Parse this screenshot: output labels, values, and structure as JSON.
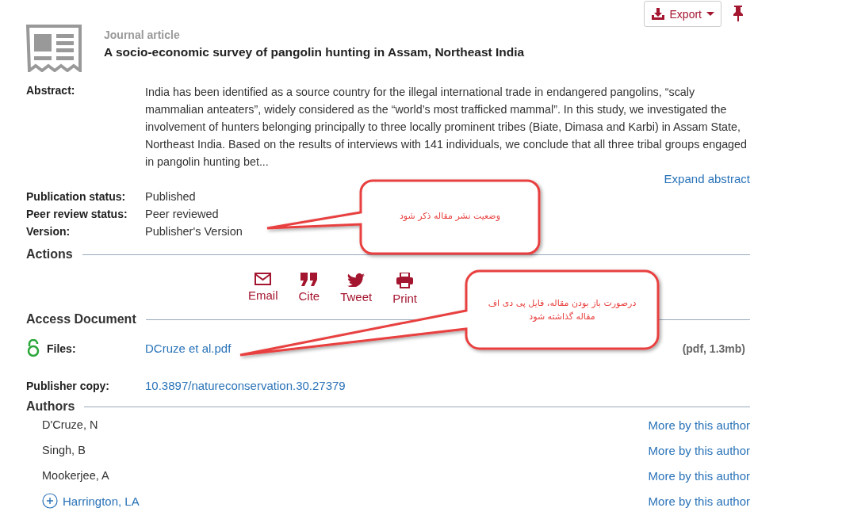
{
  "header": {
    "export_button": "Export"
  },
  "article": {
    "type": "Journal article",
    "title": "A socio-economic survey of pangolin hunting in Assam, Northeast India"
  },
  "abstract": {
    "label": "Abstract:",
    "text": "India has been identified as a source country for the illegal international trade in endangered pangolins, “scaly mammalian anteaters”, widely considered as the “world’s most trafficked mammal”. In this study, we investigated the involvement of hunters belonging principally to three locally prominent tribes (Biate, Dimasa and Karbi) in Assam State, Northeast India. Based on the results of interviews with 141 individuals, we conclude that all three tribal groups engaged in pangolin hunting bet...",
    "expand_link": "Expand abstract"
  },
  "details": [
    {
      "label": "Publication status:",
      "value": "Published"
    },
    {
      "label": "Peer review status:",
      "value": "Peer reviewed"
    },
    {
      "label": "Version:",
      "value": "Publisher's Version"
    }
  ],
  "actions": {
    "heading": "Actions",
    "items": [
      {
        "kind": "email",
        "label": "Email"
      },
      {
        "kind": "cite",
        "label": "Cite"
      },
      {
        "kind": "tweet",
        "label": "Tweet"
      },
      {
        "kind": "print",
        "label": "Print"
      }
    ]
  },
  "access": {
    "heading": "Access Document",
    "files": {
      "label": "Files:",
      "link": "DCruze et al.pdf",
      "info": "(pdf, 1.3mb)"
    },
    "publisher_copy": {
      "label": "Publisher copy:",
      "link": "10.3897/natureconservation.30.27379"
    }
  },
  "authors": {
    "heading": "Authors",
    "items": [
      {
        "name": "D'Cruze, N",
        "expandable": false,
        "more": "More by this author"
      },
      {
        "name": "Singh, B",
        "expandable": false,
        "more": "More by this author"
      },
      {
        "name": "Mookerjee, A",
        "expandable": false,
        "more": "More by this author"
      },
      {
        "name": "Harrington, LA",
        "expandable": true,
        "more": "More by this author"
      }
    ]
  },
  "annotations": [
    {
      "text": "وضعیت نشر مقاله ذکر شود"
    },
    {
      "text": "درصورت باز بودن مقاله، فایل پی دی اف مقاله گذاشته شود"
    }
  ]
}
